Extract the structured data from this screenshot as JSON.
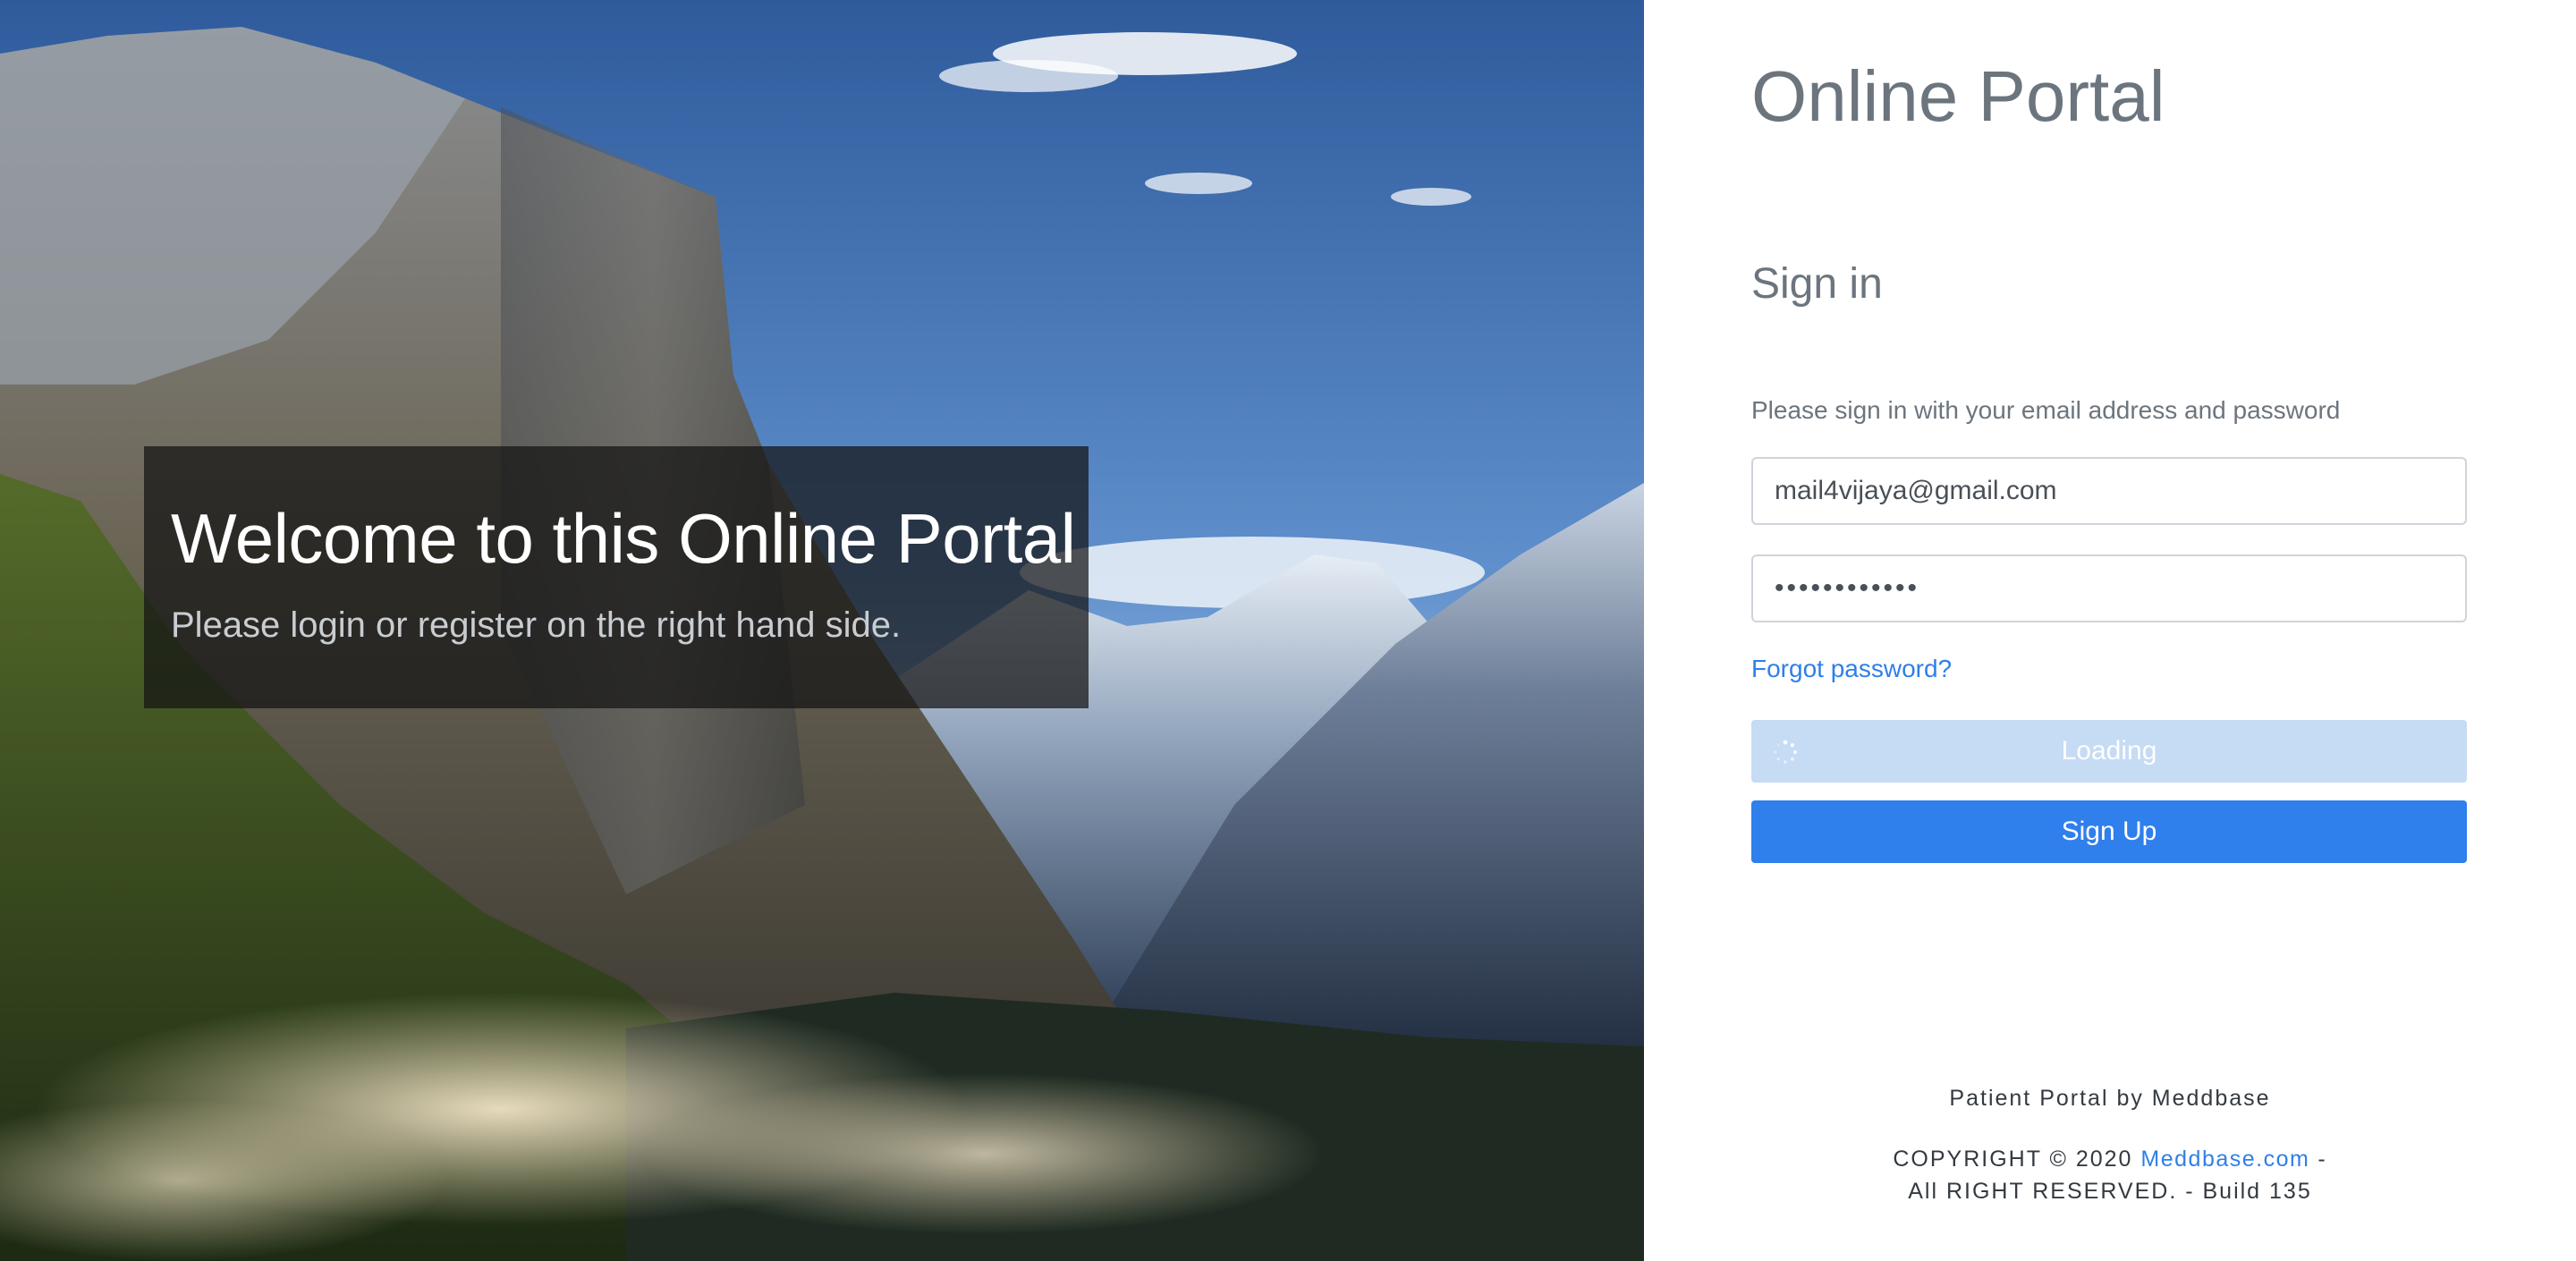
{
  "hero": {
    "welcome_title": "Welcome to this Online Portal",
    "welcome_subtitle": "Please login or register on the right hand side.",
    "background": "mountain-valley-landscape"
  },
  "panel": {
    "portal_title": "Online Portal",
    "signin_heading": "Sign in",
    "instructions": "Please sign in with your email address and password",
    "email": {
      "value": "mail4vijaya@gmail.com",
      "placeholder": ""
    },
    "password": {
      "value": "••••••••••••",
      "placeholder": ""
    },
    "forgot_link": "Forgot password?",
    "loading_label": "Loading",
    "signup_label": "Sign Up"
  },
  "footer": {
    "byline": "Patient Portal by Meddbase",
    "copyright_prefix": "COPYRIGHT © 2020",
    "link": "Meddbase.com",
    "copyright_suffix": "-",
    "rights": "All RIGHT RESERVED. - Build 135"
  },
  "colors": {
    "primary": "#2f7fed",
    "loading": "#c6dbf4",
    "muted_text": "#6c757d",
    "link": "#2f7fe8"
  },
  "icons": [
    "spinner-icon"
  ]
}
